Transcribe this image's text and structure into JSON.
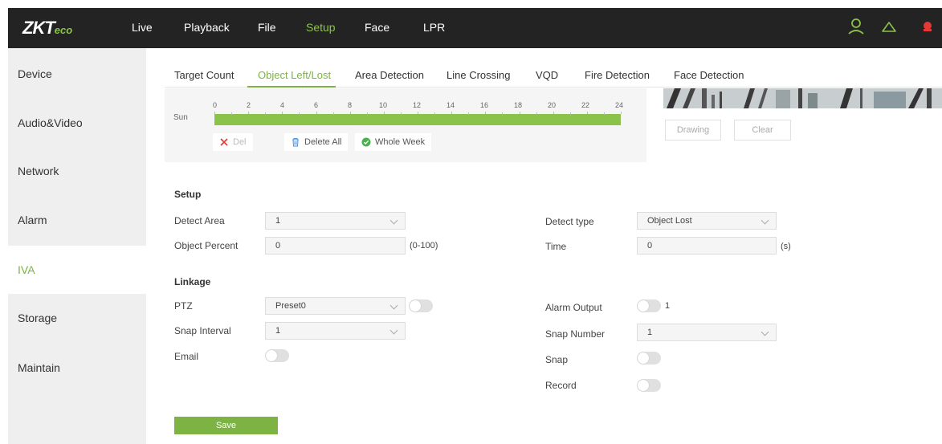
{
  "brand": {
    "logo_main": "ZKT",
    "logo_sub": "eco"
  },
  "nav": [
    "Live",
    "Playback",
    "File",
    "Setup",
    "Face",
    "LPR"
  ],
  "nav_active": "Setup",
  "sidebar": {
    "items": [
      {
        "label": "Device"
      },
      {
        "label": "Audio&Video"
      },
      {
        "label": "Network"
      },
      {
        "label": "Alarm"
      },
      {
        "label": "IVA"
      },
      {
        "label": "Storage"
      },
      {
        "label": "Maintain"
      }
    ],
    "active": "IVA"
  },
  "tabs": [
    "Target Count",
    "Object Left/Lost",
    "Area Detection",
    "Line Crossing",
    "VQD",
    "Fire Detection",
    "Face Detection"
  ],
  "tab_active": "Object Left/Lost",
  "schedule": {
    "hours": [
      "0",
      "2",
      "4",
      "6",
      "8",
      "10",
      "12",
      "14",
      "16",
      "18",
      "20",
      "22",
      "24"
    ],
    "day": "Sun",
    "del_label": "Del",
    "delete_all_label": "Delete All",
    "whole_week_label": "Whole Week"
  },
  "preview_controls": {
    "drawing": "Drawing",
    "clear": "Clear"
  },
  "setup": {
    "title": "Setup",
    "detect_area_label": "Detect Area",
    "detect_area_value": "1",
    "object_percent_label": "Object Percent",
    "object_percent_value": "0",
    "object_percent_range": "(0-100)",
    "detect_type_label": "Detect type",
    "detect_type_value": "Object Lost",
    "time_label": "Time",
    "time_value": "0",
    "time_unit": "(s)"
  },
  "linkage": {
    "title": "Linkage",
    "ptz_label": "PTZ",
    "ptz_value": "Preset0",
    "snap_interval_label": "Snap Interval",
    "snap_interval_value": "1",
    "email_label": "Email",
    "alarm_output_label": "Alarm Output",
    "alarm_output_value": "1",
    "snap_number_label": "Snap Number",
    "snap_number_value": "1",
    "snap_label": "Snap",
    "record_label": "Record"
  },
  "save_label": "Save",
  "colors": {
    "accent": "#7cb342",
    "topbar": "#232323",
    "sidebar": "#efefef"
  }
}
